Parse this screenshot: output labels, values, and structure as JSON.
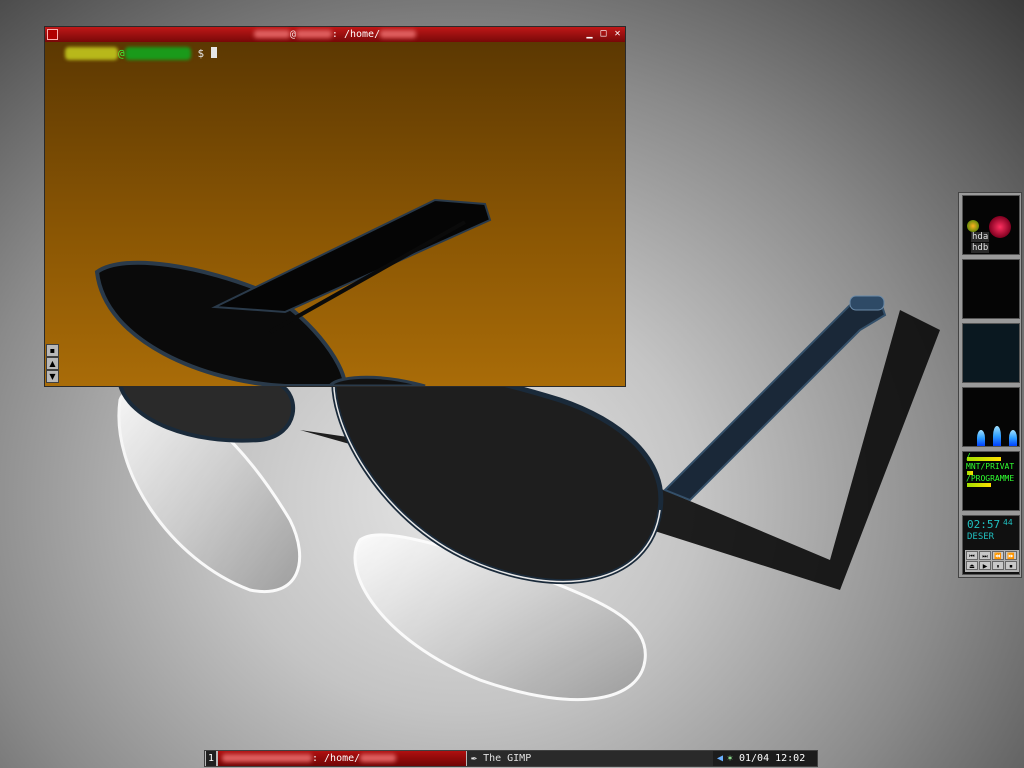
{
  "terminal": {
    "title_separator": "@",
    "title_path": ": /home/",
    "prompt_at": "@",
    "prompt_symbol": "$"
  },
  "terminal_buttons": {
    "minimize": "▁",
    "maximize": "□",
    "close": "✕"
  },
  "scrollbar": {
    "button": "▪",
    "up": "▲",
    "down": "▼"
  },
  "dock": {
    "disk_labels": [
      "hda",
      "hdb"
    ],
    "mounts": [
      "/",
      "MNT/PRIVAT",
      "/PROGRAMME"
    ],
    "player_time": "02:57",
    "player_seconds": "44",
    "player_track": "DESER",
    "player_controls": [
      "⏮",
      "⏭",
      "⏪",
      "⏩",
      "⏏",
      "▶",
      "⏸",
      "⏹"
    ]
  },
  "taskbar": {
    "workspace": "1",
    "tasks": [
      {
        "label": ": /home/",
        "active": true
      },
      {
        "label": "The GIMP",
        "active": false
      }
    ],
    "clock": "01/04 12:02"
  },
  "colors": {
    "terminal_bg": "#7a4a02",
    "titlebar_red": "#c01818",
    "prompt_user": "#b8b81a",
    "prompt_host": "#1a9a1a"
  }
}
